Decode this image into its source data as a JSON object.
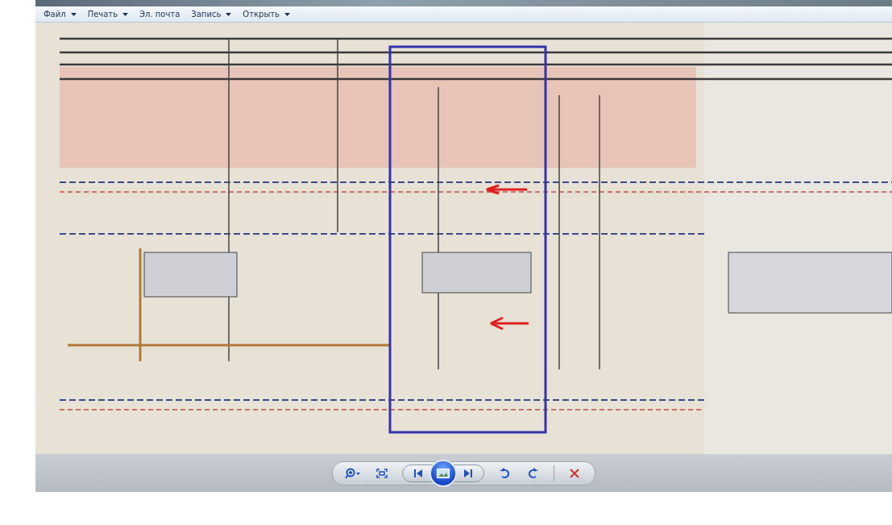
{
  "menu": [
    {
      "label": "Файл",
      "dropdown": true
    },
    {
      "label": "Печать",
      "dropdown": true
    },
    {
      "label": "Эл. почта",
      "dropdown": false
    },
    {
      "label": "Запись",
      "dropdown": true
    },
    {
      "label": "Открыть",
      "dropdown": true
    }
  ]
}
